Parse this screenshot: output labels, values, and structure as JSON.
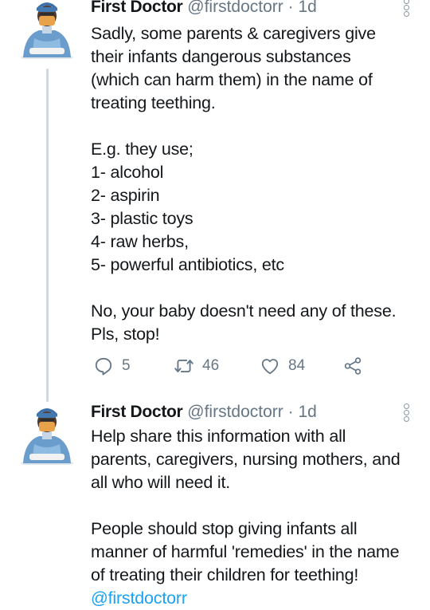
{
  "tweets": [
    {
      "name": "First Doctor",
      "handle": "@firstdoctorr",
      "separator": "·",
      "time": "1d",
      "lines": [
        "Sadly, some parents & caregivers give",
        "their infants dangerous substances",
        "(which can harm them) in the name of",
        "treating teething.",
        "",
        "E.g. they use;",
        "1- alcohol",
        "2- aspirin",
        "3- plastic toys",
        "4- raw herbs,",
        "5- powerful antibiotics, etc",
        "",
        "No, your baby doesn't need any of these.",
        "Pls, stop!"
      ],
      "actions": {
        "replies": "5",
        "retweets": "46",
        "likes": "84"
      }
    },
    {
      "name": "First Doctor",
      "handle": "@firstdoctorr",
      "separator": "·",
      "time": "1d",
      "lines": [
        "Help share this information with all",
        "parents, caregivers, nursing mothers, and",
        "all who will need it.",
        "",
        "People should stop giving infants all",
        "manner of harmful 'remedies' in the name",
        "of treating their children for teething!"
      ],
      "mention": "@firstdoctorr"
    }
  ],
  "icons": {
    "avatar": "doctor-avatar",
    "reply": "reply-icon",
    "retweet": "retweet-icon",
    "like": "heart-icon",
    "share": "share-icon",
    "more": "more-options-icon"
  },
  "colors": {
    "text": "#14171a",
    "secondary": "#657786",
    "link": "#1da1f2",
    "thread": "#cfd9de"
  }
}
